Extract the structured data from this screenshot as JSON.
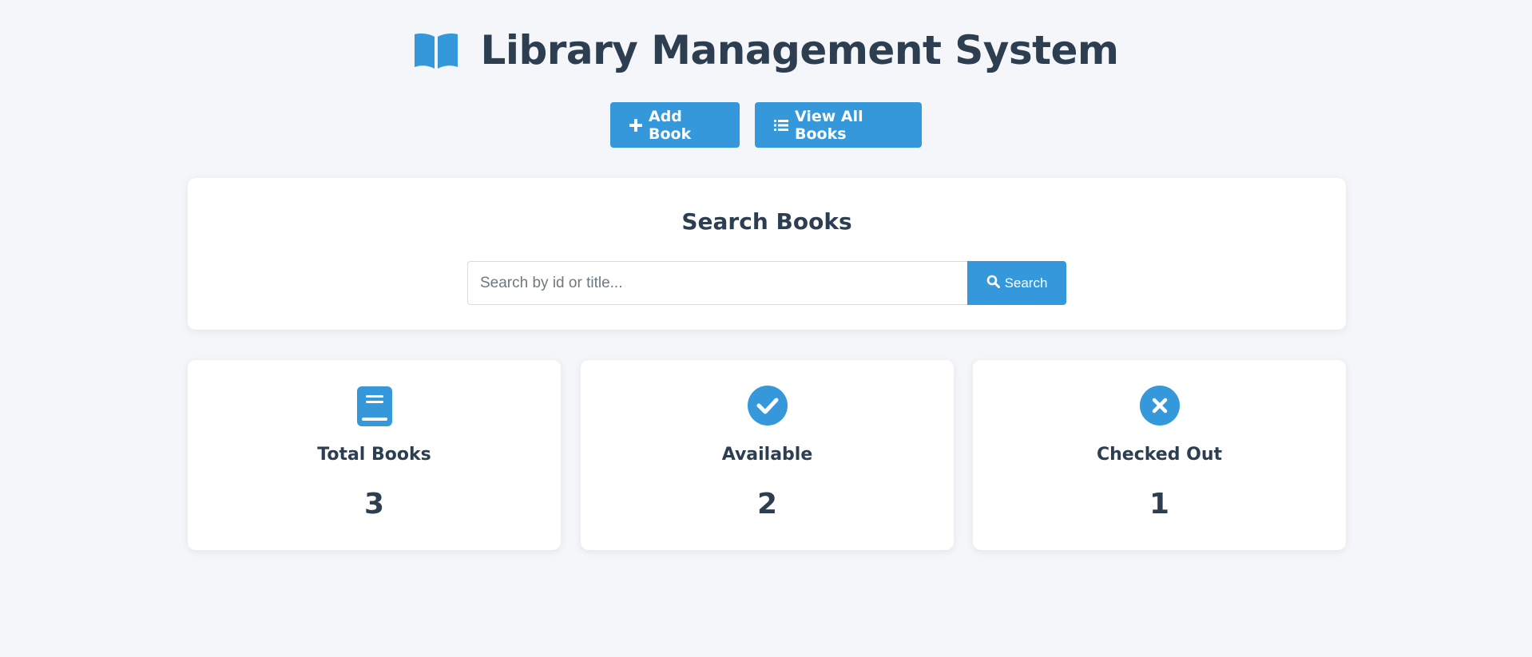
{
  "header": {
    "title": "Library Management System"
  },
  "nav": {
    "add_book_label": "Add Book",
    "view_all_label": "View All Books"
  },
  "search": {
    "title": "Search Books",
    "placeholder": "Search by id or title...",
    "value": "",
    "button_label": "Search"
  },
  "stats": [
    {
      "label": "Total Books",
      "value": "3",
      "icon": "book-icon"
    },
    {
      "label": "Available",
      "value": "2",
      "icon": "check-circle-icon"
    },
    {
      "label": "Checked Out",
      "value": "1",
      "icon": "times-circle-icon"
    }
  ],
  "colors": {
    "accent": "#3498db",
    "text": "#2c3e50",
    "background": "#f4f6f9",
    "card": "#ffffff"
  }
}
